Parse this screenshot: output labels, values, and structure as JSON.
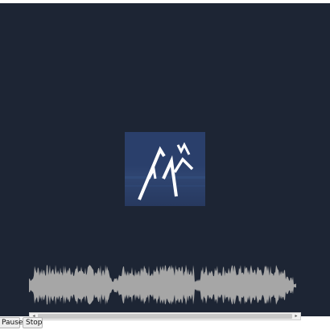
{
  "controls": {
    "pause_label": "Pause",
    "stop_label": "Stop"
  },
  "artwork": {
    "logo_icon": "ak-mountain-logo",
    "background_color": "#2a3f6b"
  },
  "waveform": {
    "color": "#a6a6a6"
  },
  "player": {
    "background_color": "#1d2534"
  }
}
